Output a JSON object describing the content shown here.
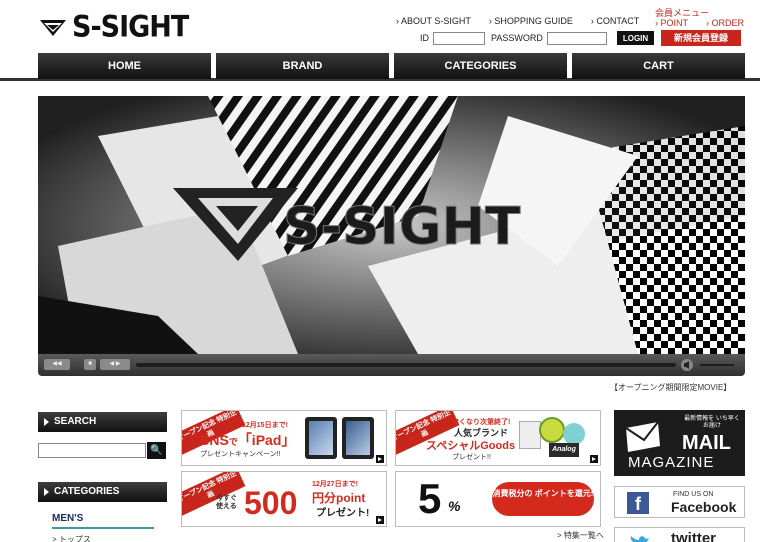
{
  "header": {
    "logo_text": "S-SIGHT",
    "links": [
      "ABOUT S-SIGHT",
      "SHOPPING GUIDE",
      "CONTACT"
    ],
    "member_menu_title": "会員メニュー",
    "member_links": [
      "POINT",
      "ORDER"
    ],
    "id_label": "ID",
    "id_value": "",
    "password_label": "PASSWORD",
    "password_value": "",
    "login_label": "LOGIN",
    "register_label": "新規会員登録"
  },
  "nav": [
    "HOME",
    "BRAND",
    "CATEGORIES",
    "CART"
  ],
  "video": {
    "overlay_text": "S-SIGHT",
    "caption": "【オープニング期間限定MOVIE】",
    "controls": [
      "◀◀",
      "■",
      "◀ ▶"
    ]
  },
  "sidebar": {
    "search_title": "SEARCH",
    "search_value": "",
    "search_button": "🔍",
    "categories_title": "CATEGORIES",
    "mens": "MEN'S",
    "mens_first_item": "> トップス"
  },
  "banners": {
    "b1": {
      "ribbon": "オープン記念 特別企画",
      "date": "12月15日まで!",
      "headline_a": "SNS",
      "headline_b": "で",
      "headline_c": "「iPad」",
      "sub": "プレゼントキャンペーン!!"
    },
    "b2": {
      "ribbon": "オープン記念 特別企画",
      "top": "無くなり次第終了!",
      "l1": "人気ブランド",
      "l2": "スペシャルGoods",
      "l3": "プレゼント!!",
      "tag": "Analog"
    },
    "b3": {
      "ribbon": "オープン記念 特別企画",
      "date": "12月27日まで!",
      "left": "今すぐ 使える",
      "num": "500",
      "unit": "円分point",
      "sub": "プレゼント!"
    },
    "b4": {
      "num": "5",
      "pct": "%",
      "pill": "消費税分の ポイントを還元!"
    },
    "more": "> 特集一覧へ"
  },
  "right": {
    "mail_small": "最新情報を いち早くお届け",
    "mail_big": "MAIL",
    "mail_sub": "MAGAZINE",
    "fb_small": "FIND US ON",
    "fb_big": "Facebook",
    "tw": "twitter"
  },
  "colors": {
    "accent_red": "#c8261c",
    "nav_dark": "#111111",
    "teal": "#3a9c9c",
    "fb_blue": "#3b5998"
  }
}
